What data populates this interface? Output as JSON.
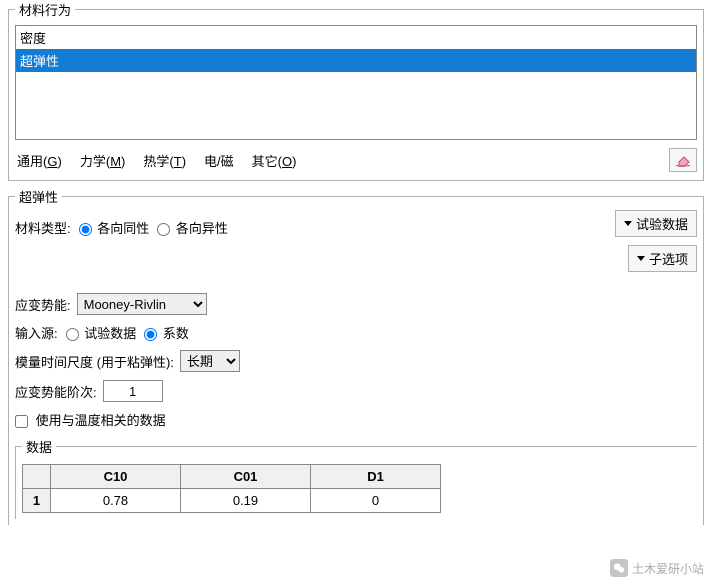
{
  "behavior": {
    "legend": "材料行为",
    "items": [
      "密度",
      "超弹性"
    ],
    "selected_index": 1
  },
  "tabs": {
    "general": {
      "text": "通用",
      "key": "G"
    },
    "mechanical": {
      "text": "力学",
      "key": "M"
    },
    "thermal": {
      "text": "热学",
      "key": "T"
    },
    "electrical": {
      "text": "电/磁",
      "key": ""
    },
    "other": {
      "text": "其它",
      "key": "O"
    }
  },
  "hyper": {
    "legend": "超弹性",
    "mat_type_label": "材料类型:",
    "radio_iso": "各向同性",
    "radio_aniso": "各向异性",
    "mat_type_value": "iso",
    "test_data_btn": "试验数据",
    "suboptions_btn": "子选项",
    "potential_label": "应变势能:",
    "potential_value": "Mooney-Rivlin",
    "source_label": "输入源:",
    "source_radio_test": "试验数据",
    "source_radio_coef": "系数",
    "source_value": "coef",
    "timescale_label": "模量时间尺度 (用于粘弹性):",
    "timescale_value": "长期",
    "order_label": "应变势能阶次:",
    "order_value": "1",
    "temp_check_label": "使用与温度相关的数据",
    "temp_checked": false,
    "data_legend": "数据",
    "table": {
      "headers": [
        "C10",
        "C01",
        "D1"
      ],
      "row_label": "1",
      "values": [
        "0.78",
        "0.19",
        "0"
      ]
    }
  },
  "watermark": "土木爱研小站"
}
